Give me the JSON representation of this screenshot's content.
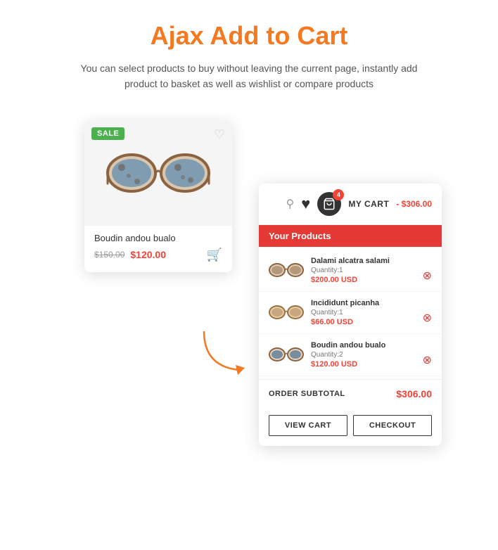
{
  "header": {
    "title": "Ajax Add to Cart",
    "subtitle": "You can select products to buy without leaving the current page, instantly add product to basket as well as wishlist or compare products"
  },
  "product_card": {
    "sale_badge": "SALE",
    "name": "Boudin andou bualo",
    "old_price": "$150.00",
    "new_price": "$120.00"
  },
  "cart": {
    "header": {
      "label": "MY CART",
      "total": "- $306.00",
      "badge_count": "4"
    },
    "section_title": "Your Products",
    "items": [
      {
        "name": "Dalami alcatra salami",
        "quantity": "Quantity:1",
        "price": "$200.00 USD"
      },
      {
        "name": "Incididunt picanha",
        "quantity": "Quantity:1",
        "price": "$66.00 USD"
      },
      {
        "name": "Boudin andou bualo",
        "quantity": "Quantity:2",
        "price": "$120.00 USD"
      }
    ],
    "subtotal_label": "ORDER SUBTOTAL",
    "subtotal_value": "$306.00",
    "view_cart_label": "VIEW CART",
    "checkout_label": "CHECKOUT"
  },
  "colors": {
    "orange": "#f47920",
    "red": "#e53935",
    "green": "#4caf50",
    "dark": "#333333"
  }
}
